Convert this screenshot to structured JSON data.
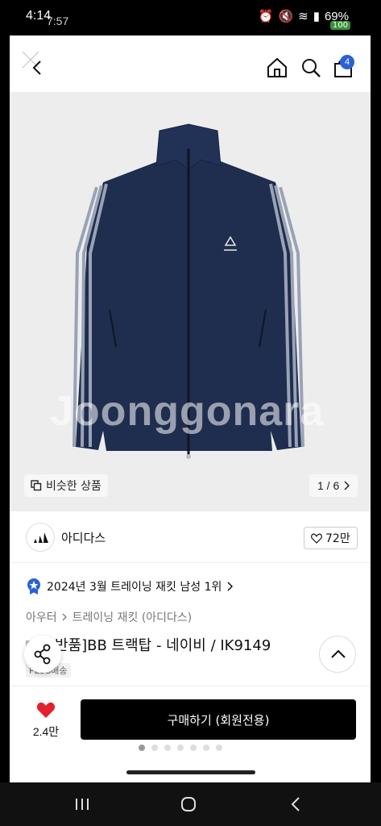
{
  "status_bar": {
    "time": "4:14",
    "time_overlay": "7:57",
    "battery_percent": "69%",
    "battery_badge": "100",
    "network_label": "LTE"
  },
  "top_nav": {
    "cart_badge": "4",
    "icons": [
      "close-icon",
      "back-icon",
      "home-icon",
      "search-icon",
      "shopping-bag-icon"
    ]
  },
  "hero": {
    "watermark": "Joonggonara",
    "similar_label": "비슷한 상품",
    "pager_text": "1 / 6",
    "image_count": 6,
    "current_image": 1
  },
  "brand": {
    "name": "아디다스",
    "likes": "72만"
  },
  "ranking": {
    "text": "2024년 3월 트레이닝 재킷 남성 1위"
  },
  "breadcrumb": {
    "level1": "아우터",
    "level2": "트레이닝 재킷 (아디다스)"
  },
  "product": {
    "title_visible": "반품]BB 트랙탑 - 네이비 / IK9149",
    "shipping_tag": "PLUS배송"
  },
  "bottom_bar": {
    "wish_count": "2.4만",
    "buy_label": "구매하기 (회원전용)",
    "page_dots": 7,
    "active_dot": 0
  },
  "colors": {
    "accent_blue": "#2a62d6",
    "heart_red": "#e3202e",
    "jacket_navy": "#1f2d4f",
    "buy_button": "#000000"
  }
}
